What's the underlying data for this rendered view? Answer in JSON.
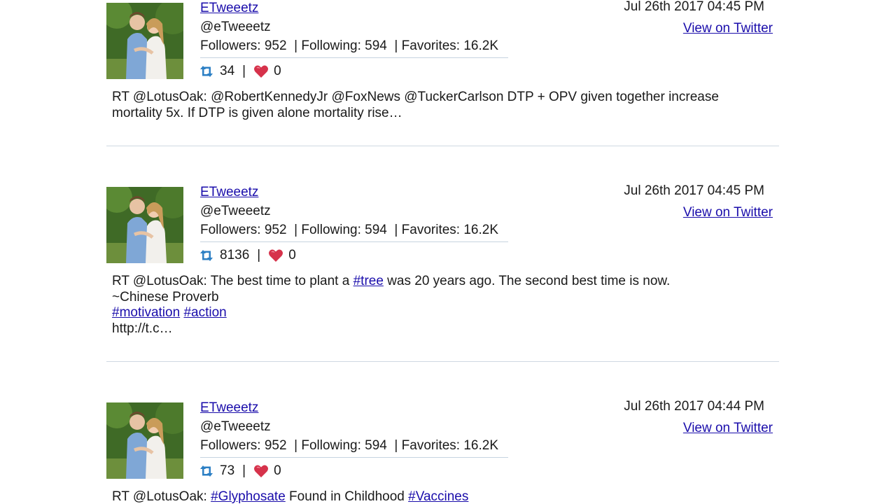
{
  "colors": {
    "link": "#1a0dab",
    "text": "#1a1a1a",
    "retweet_icon": "#2c7fc4",
    "heart_icon": "#d6324b",
    "divider": "#cfd8e2"
  },
  "tweets": [
    {
      "user_name": "ETweeetz",
      "handle": "@eTweeetz",
      "stats": {
        "followers": "Followers: 952",
        "following": "Following: 594",
        "favorites": "Favorites: 16.2K"
      },
      "retweets": "34",
      "count_separator": "|",
      "likes": "0",
      "date": "Jul 26th 2017 04:45 PM",
      "view_label": "View on Twitter",
      "text": {
        "line1": "RT @LotusOak: @RobertKennedyJr @FoxNews @TuckerCarlson DTP + OPV given together increase",
        "line2": "mortality 5x. If DTP is given alone mortality rise…"
      }
    },
    {
      "user_name": "ETweeetz",
      "handle": "@eTweeetz",
      "stats": {
        "followers": "Followers: 952",
        "following": "Following: 594",
        "favorites": "Favorites: 16.2K"
      },
      "retweets": "8136",
      "count_separator": "|",
      "likes": "0",
      "date": "Jul 26th 2017 04:45 PM",
      "view_label": "View on Twitter",
      "text": {
        "line1_a": "RT @LotusOak: The best time to plant a ",
        "tag_tree": "#tree",
        "line1_b": " was 20 years ago. The second best time is now.",
        "line2": "~Chinese Proverb",
        "tag_motivation": "#motivation",
        "tag_action": "#action",
        "line4": "http://t.c…"
      }
    },
    {
      "user_name": "ETweeetz",
      "handle": "@eTweeetz",
      "stats": {
        "followers": "Followers: 952",
        "following": "Following: 594",
        "favorites": "Favorites: 16.2K"
      },
      "retweets": "73",
      "count_separator": "|",
      "likes": "0",
      "date": "Jul 26th 2017 04:44 PM",
      "view_label": "View on Twitter",
      "text": {
        "line1_a": "RT @LotusOak: ",
        "tag_glyphosate": "#Glyphosate",
        "line1_b": " Found in Childhood ",
        "tag_vaccines": "#Vaccines"
      }
    }
  ]
}
